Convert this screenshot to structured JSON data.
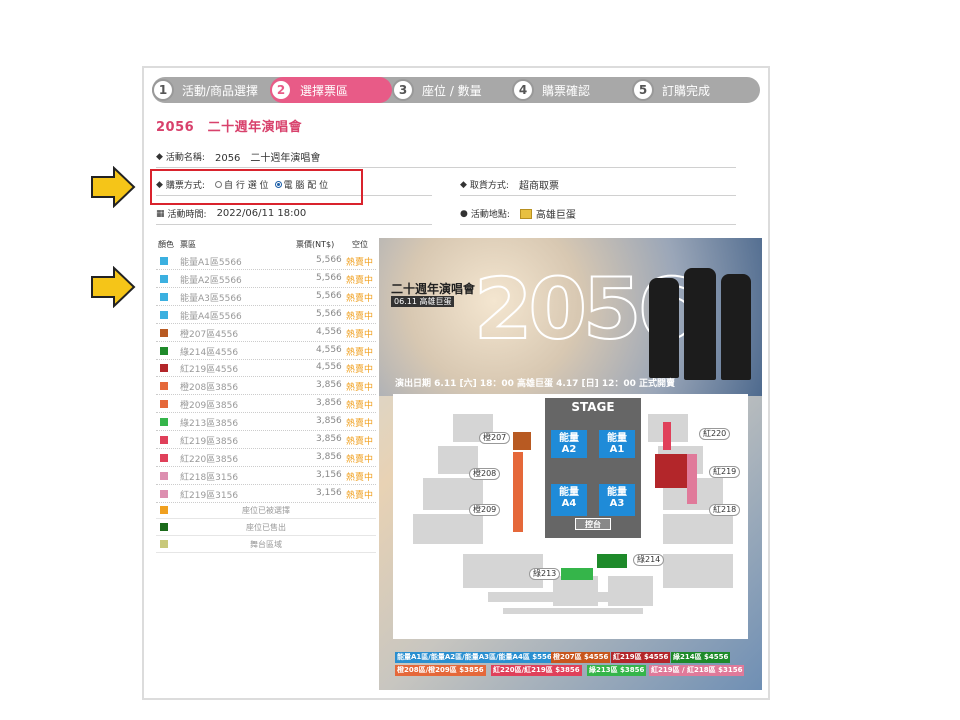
{
  "steps": [
    {
      "num": "1",
      "label": "活動/商品選擇"
    },
    {
      "num": "2",
      "label": "選擇票區"
    },
    {
      "num": "3",
      "label": "座位 / 數量"
    },
    {
      "num": "4",
      "label": "購票確認"
    },
    {
      "num": "5",
      "label": "訂購完成"
    }
  ],
  "event_title": "2056　二十週年演唱會",
  "info": {
    "event_name_label": "活動名稱:",
    "event_name_value": "2056　二十週年演唱會",
    "purchase_method_label": "購票方式:",
    "option_self": "自 行 選 位",
    "option_auto": "電 腦 配 位",
    "pickup_label": "取貨方式:",
    "pickup_value": "超商取票",
    "time_label": "活動時間:",
    "time_value": "2022/06/11 18:00",
    "venue_label": "活動地點:",
    "venue_value": "高雄巨蛋"
  },
  "table": {
    "headers": {
      "color": "顏色",
      "zone": "票區",
      "price": "票價(NT$)",
      "avail": "空位"
    },
    "rows": [
      {
        "zone": "能量A1區5566",
        "price": "5,566",
        "status": "熱賣中",
        "color": "#3bb0e0"
      },
      {
        "zone": "能量A2區5566",
        "price": "5,566",
        "status": "熱賣中",
        "color": "#3bb0e0"
      },
      {
        "zone": "能量A3區5566",
        "price": "5,566",
        "status": "熱賣中",
        "color": "#3bb0e0"
      },
      {
        "zone": "能量A4區5566",
        "price": "5,566",
        "status": "熱賣中",
        "color": "#3bb0e0"
      },
      {
        "zone": "橙207區4556",
        "price": "4,556",
        "status": "熱賣中",
        "color": "#b85a22"
      },
      {
        "zone": "綠214區4556",
        "price": "4,556",
        "status": "熱賣中",
        "color": "#1e8a2a"
      },
      {
        "zone": "紅219區4556",
        "price": "4,556",
        "status": "熱賣中",
        "color": "#b3262a"
      },
      {
        "zone": "橙208區3856",
        "price": "3,856",
        "status": "熱賣中",
        "color": "#e5683a"
      },
      {
        "zone": "橙209區3856",
        "price": "3,856",
        "status": "熱賣中",
        "color": "#e5683a"
      },
      {
        "zone": "綠213區3856",
        "price": "3,856",
        "status": "熱賣中",
        "color": "#35b54a"
      },
      {
        "zone": "紅219區3856",
        "price": "3,856",
        "status": "熱賣中",
        "color": "#e0405a"
      },
      {
        "zone": "紅220區3856",
        "price": "3,856",
        "status": "熱賣中",
        "color": "#e0405a"
      },
      {
        "zone": "紅218區3156",
        "price": "3,156",
        "status": "熱賣中",
        "color": "#dd8fb0"
      },
      {
        "zone": "紅219區3156",
        "price": "3,156",
        "status": "熱賣中",
        "color": "#dd8fb0"
      }
    ],
    "legend": [
      {
        "label": "座位已被選擇",
        "color": "#f0a020"
      },
      {
        "label": "座位已售出",
        "color": "#1a6a1a"
      },
      {
        "label": "舞台區域",
        "color": "#c8c87a"
      }
    ]
  },
  "poster": {
    "title_big": "2056",
    "sub1": "二十週年演唱會",
    "sub2": "06.11 高雄巨蛋",
    "date_line": "演出日期 6.11 [六] 18：00  高雄巨蛋   4.17 [日] 12：00 正式開賣",
    "stage": "STAGE",
    "control": "控台",
    "blocks": [
      {
        "name": "能量",
        "sub": "A2"
      },
      {
        "name": "能量",
        "sub": "A1"
      },
      {
        "name": "能量",
        "sub": "A4"
      },
      {
        "name": "能量",
        "sub": "A3"
      }
    ],
    "labels": {
      "z207": "橙207",
      "z208": "橙208",
      "z209": "橙209",
      "z213": "綠213",
      "z214": "綠214",
      "z218": "紅218",
      "z219": "紅219",
      "z220": "紅220"
    },
    "price_bar_1": [
      {
        "text": "能量A1區/能量A2區/能量A3區/能量A4區 $5566",
        "color": "#2a8fd0"
      },
      {
        "text": "橙207區 $4556",
        "color": "#c8561d"
      },
      {
        "text": "紅219區 $4556",
        "color": "#b3262a"
      },
      {
        "text": "綠214區 $4556",
        "color": "#1e8a2a"
      }
    ],
    "price_bar_2": [
      {
        "text": "橙208區/橙209區 $3856",
        "color": "#e5683a"
      },
      {
        "text": "紅220區/紅219區 $3856",
        "color": "#e0405a"
      },
      {
        "text": "綠213區 $3856",
        "color": "#35b54a"
      },
      {
        "text": "紅219區 / 紅218區 $3156",
        "color": "#e07a9a"
      }
    ]
  }
}
